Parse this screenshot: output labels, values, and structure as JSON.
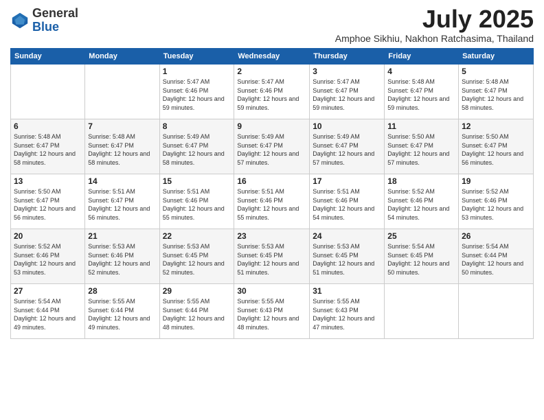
{
  "logo": {
    "general": "General",
    "blue": "Blue"
  },
  "header": {
    "month": "July 2025",
    "location": "Amphoe Sikhiu, Nakhon Ratchasima, Thailand"
  },
  "weekdays": [
    "Sunday",
    "Monday",
    "Tuesday",
    "Wednesday",
    "Thursday",
    "Friday",
    "Saturday"
  ],
  "weeks": [
    [
      {
        "day": "",
        "sunrise": "",
        "sunset": "",
        "daylight": ""
      },
      {
        "day": "",
        "sunrise": "",
        "sunset": "",
        "daylight": ""
      },
      {
        "day": "1",
        "sunrise": "Sunrise: 5:47 AM",
        "sunset": "Sunset: 6:46 PM",
        "daylight": "Daylight: 12 hours and 59 minutes."
      },
      {
        "day": "2",
        "sunrise": "Sunrise: 5:47 AM",
        "sunset": "Sunset: 6:46 PM",
        "daylight": "Daylight: 12 hours and 59 minutes."
      },
      {
        "day": "3",
        "sunrise": "Sunrise: 5:47 AM",
        "sunset": "Sunset: 6:47 PM",
        "daylight": "Daylight: 12 hours and 59 minutes."
      },
      {
        "day": "4",
        "sunrise": "Sunrise: 5:48 AM",
        "sunset": "Sunset: 6:47 PM",
        "daylight": "Daylight: 12 hours and 59 minutes."
      },
      {
        "day": "5",
        "sunrise": "Sunrise: 5:48 AM",
        "sunset": "Sunset: 6:47 PM",
        "daylight": "Daylight: 12 hours and 58 minutes."
      }
    ],
    [
      {
        "day": "6",
        "sunrise": "Sunrise: 5:48 AM",
        "sunset": "Sunset: 6:47 PM",
        "daylight": "Daylight: 12 hours and 58 minutes."
      },
      {
        "day": "7",
        "sunrise": "Sunrise: 5:48 AM",
        "sunset": "Sunset: 6:47 PM",
        "daylight": "Daylight: 12 hours and 58 minutes."
      },
      {
        "day": "8",
        "sunrise": "Sunrise: 5:49 AM",
        "sunset": "Sunset: 6:47 PM",
        "daylight": "Daylight: 12 hours and 58 minutes."
      },
      {
        "day": "9",
        "sunrise": "Sunrise: 5:49 AM",
        "sunset": "Sunset: 6:47 PM",
        "daylight": "Daylight: 12 hours and 57 minutes."
      },
      {
        "day": "10",
        "sunrise": "Sunrise: 5:49 AM",
        "sunset": "Sunset: 6:47 PM",
        "daylight": "Daylight: 12 hours and 57 minutes."
      },
      {
        "day": "11",
        "sunrise": "Sunrise: 5:50 AM",
        "sunset": "Sunset: 6:47 PM",
        "daylight": "Daylight: 12 hours and 57 minutes."
      },
      {
        "day": "12",
        "sunrise": "Sunrise: 5:50 AM",
        "sunset": "Sunset: 6:47 PM",
        "daylight": "Daylight: 12 hours and 56 minutes."
      }
    ],
    [
      {
        "day": "13",
        "sunrise": "Sunrise: 5:50 AM",
        "sunset": "Sunset: 6:47 PM",
        "daylight": "Daylight: 12 hours and 56 minutes."
      },
      {
        "day": "14",
        "sunrise": "Sunrise: 5:51 AM",
        "sunset": "Sunset: 6:47 PM",
        "daylight": "Daylight: 12 hours and 56 minutes."
      },
      {
        "day": "15",
        "sunrise": "Sunrise: 5:51 AM",
        "sunset": "Sunset: 6:46 PM",
        "daylight": "Daylight: 12 hours and 55 minutes."
      },
      {
        "day": "16",
        "sunrise": "Sunrise: 5:51 AM",
        "sunset": "Sunset: 6:46 PM",
        "daylight": "Daylight: 12 hours and 55 minutes."
      },
      {
        "day": "17",
        "sunrise": "Sunrise: 5:51 AM",
        "sunset": "Sunset: 6:46 PM",
        "daylight": "Daylight: 12 hours and 54 minutes."
      },
      {
        "day": "18",
        "sunrise": "Sunrise: 5:52 AM",
        "sunset": "Sunset: 6:46 PM",
        "daylight": "Daylight: 12 hours and 54 minutes."
      },
      {
        "day": "19",
        "sunrise": "Sunrise: 5:52 AM",
        "sunset": "Sunset: 6:46 PM",
        "daylight": "Daylight: 12 hours and 53 minutes."
      }
    ],
    [
      {
        "day": "20",
        "sunrise": "Sunrise: 5:52 AM",
        "sunset": "Sunset: 6:46 PM",
        "daylight": "Daylight: 12 hours and 53 minutes."
      },
      {
        "day": "21",
        "sunrise": "Sunrise: 5:53 AM",
        "sunset": "Sunset: 6:46 PM",
        "daylight": "Daylight: 12 hours and 52 minutes."
      },
      {
        "day": "22",
        "sunrise": "Sunrise: 5:53 AM",
        "sunset": "Sunset: 6:45 PM",
        "daylight": "Daylight: 12 hours and 52 minutes."
      },
      {
        "day": "23",
        "sunrise": "Sunrise: 5:53 AM",
        "sunset": "Sunset: 6:45 PM",
        "daylight": "Daylight: 12 hours and 51 minutes."
      },
      {
        "day": "24",
        "sunrise": "Sunrise: 5:53 AM",
        "sunset": "Sunset: 6:45 PM",
        "daylight": "Daylight: 12 hours and 51 minutes."
      },
      {
        "day": "25",
        "sunrise": "Sunrise: 5:54 AM",
        "sunset": "Sunset: 6:45 PM",
        "daylight": "Daylight: 12 hours and 50 minutes."
      },
      {
        "day": "26",
        "sunrise": "Sunrise: 5:54 AM",
        "sunset": "Sunset: 6:44 PM",
        "daylight": "Daylight: 12 hours and 50 minutes."
      }
    ],
    [
      {
        "day": "27",
        "sunrise": "Sunrise: 5:54 AM",
        "sunset": "Sunset: 6:44 PM",
        "daylight": "Daylight: 12 hours and 49 minutes."
      },
      {
        "day": "28",
        "sunrise": "Sunrise: 5:55 AM",
        "sunset": "Sunset: 6:44 PM",
        "daylight": "Daylight: 12 hours and 49 minutes."
      },
      {
        "day": "29",
        "sunrise": "Sunrise: 5:55 AM",
        "sunset": "Sunset: 6:44 PM",
        "daylight": "Daylight: 12 hours and 48 minutes."
      },
      {
        "day": "30",
        "sunrise": "Sunrise: 5:55 AM",
        "sunset": "Sunset: 6:43 PM",
        "daylight": "Daylight: 12 hours and 48 minutes."
      },
      {
        "day": "31",
        "sunrise": "Sunrise: 5:55 AM",
        "sunset": "Sunset: 6:43 PM",
        "daylight": "Daylight: 12 hours and 47 minutes."
      },
      {
        "day": "",
        "sunrise": "",
        "sunset": "",
        "daylight": ""
      },
      {
        "day": "",
        "sunrise": "",
        "sunset": "",
        "daylight": ""
      }
    ]
  ]
}
